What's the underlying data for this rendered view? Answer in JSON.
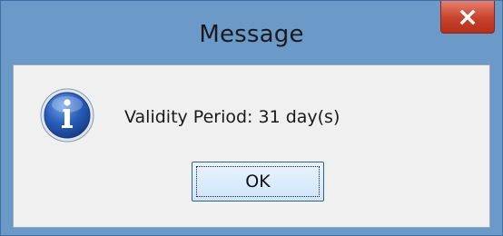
{
  "dialog": {
    "title": "Message",
    "message": "Validity Period: 31 day(s)",
    "ok_label": "OK",
    "icon": "info-icon",
    "close_icon": "close-icon"
  },
  "colors": {
    "title_bar": "#6b9ac8",
    "close_button": "#c8412b",
    "client_background": "#f0f0f0",
    "ok_button_border": "#2c628b"
  }
}
